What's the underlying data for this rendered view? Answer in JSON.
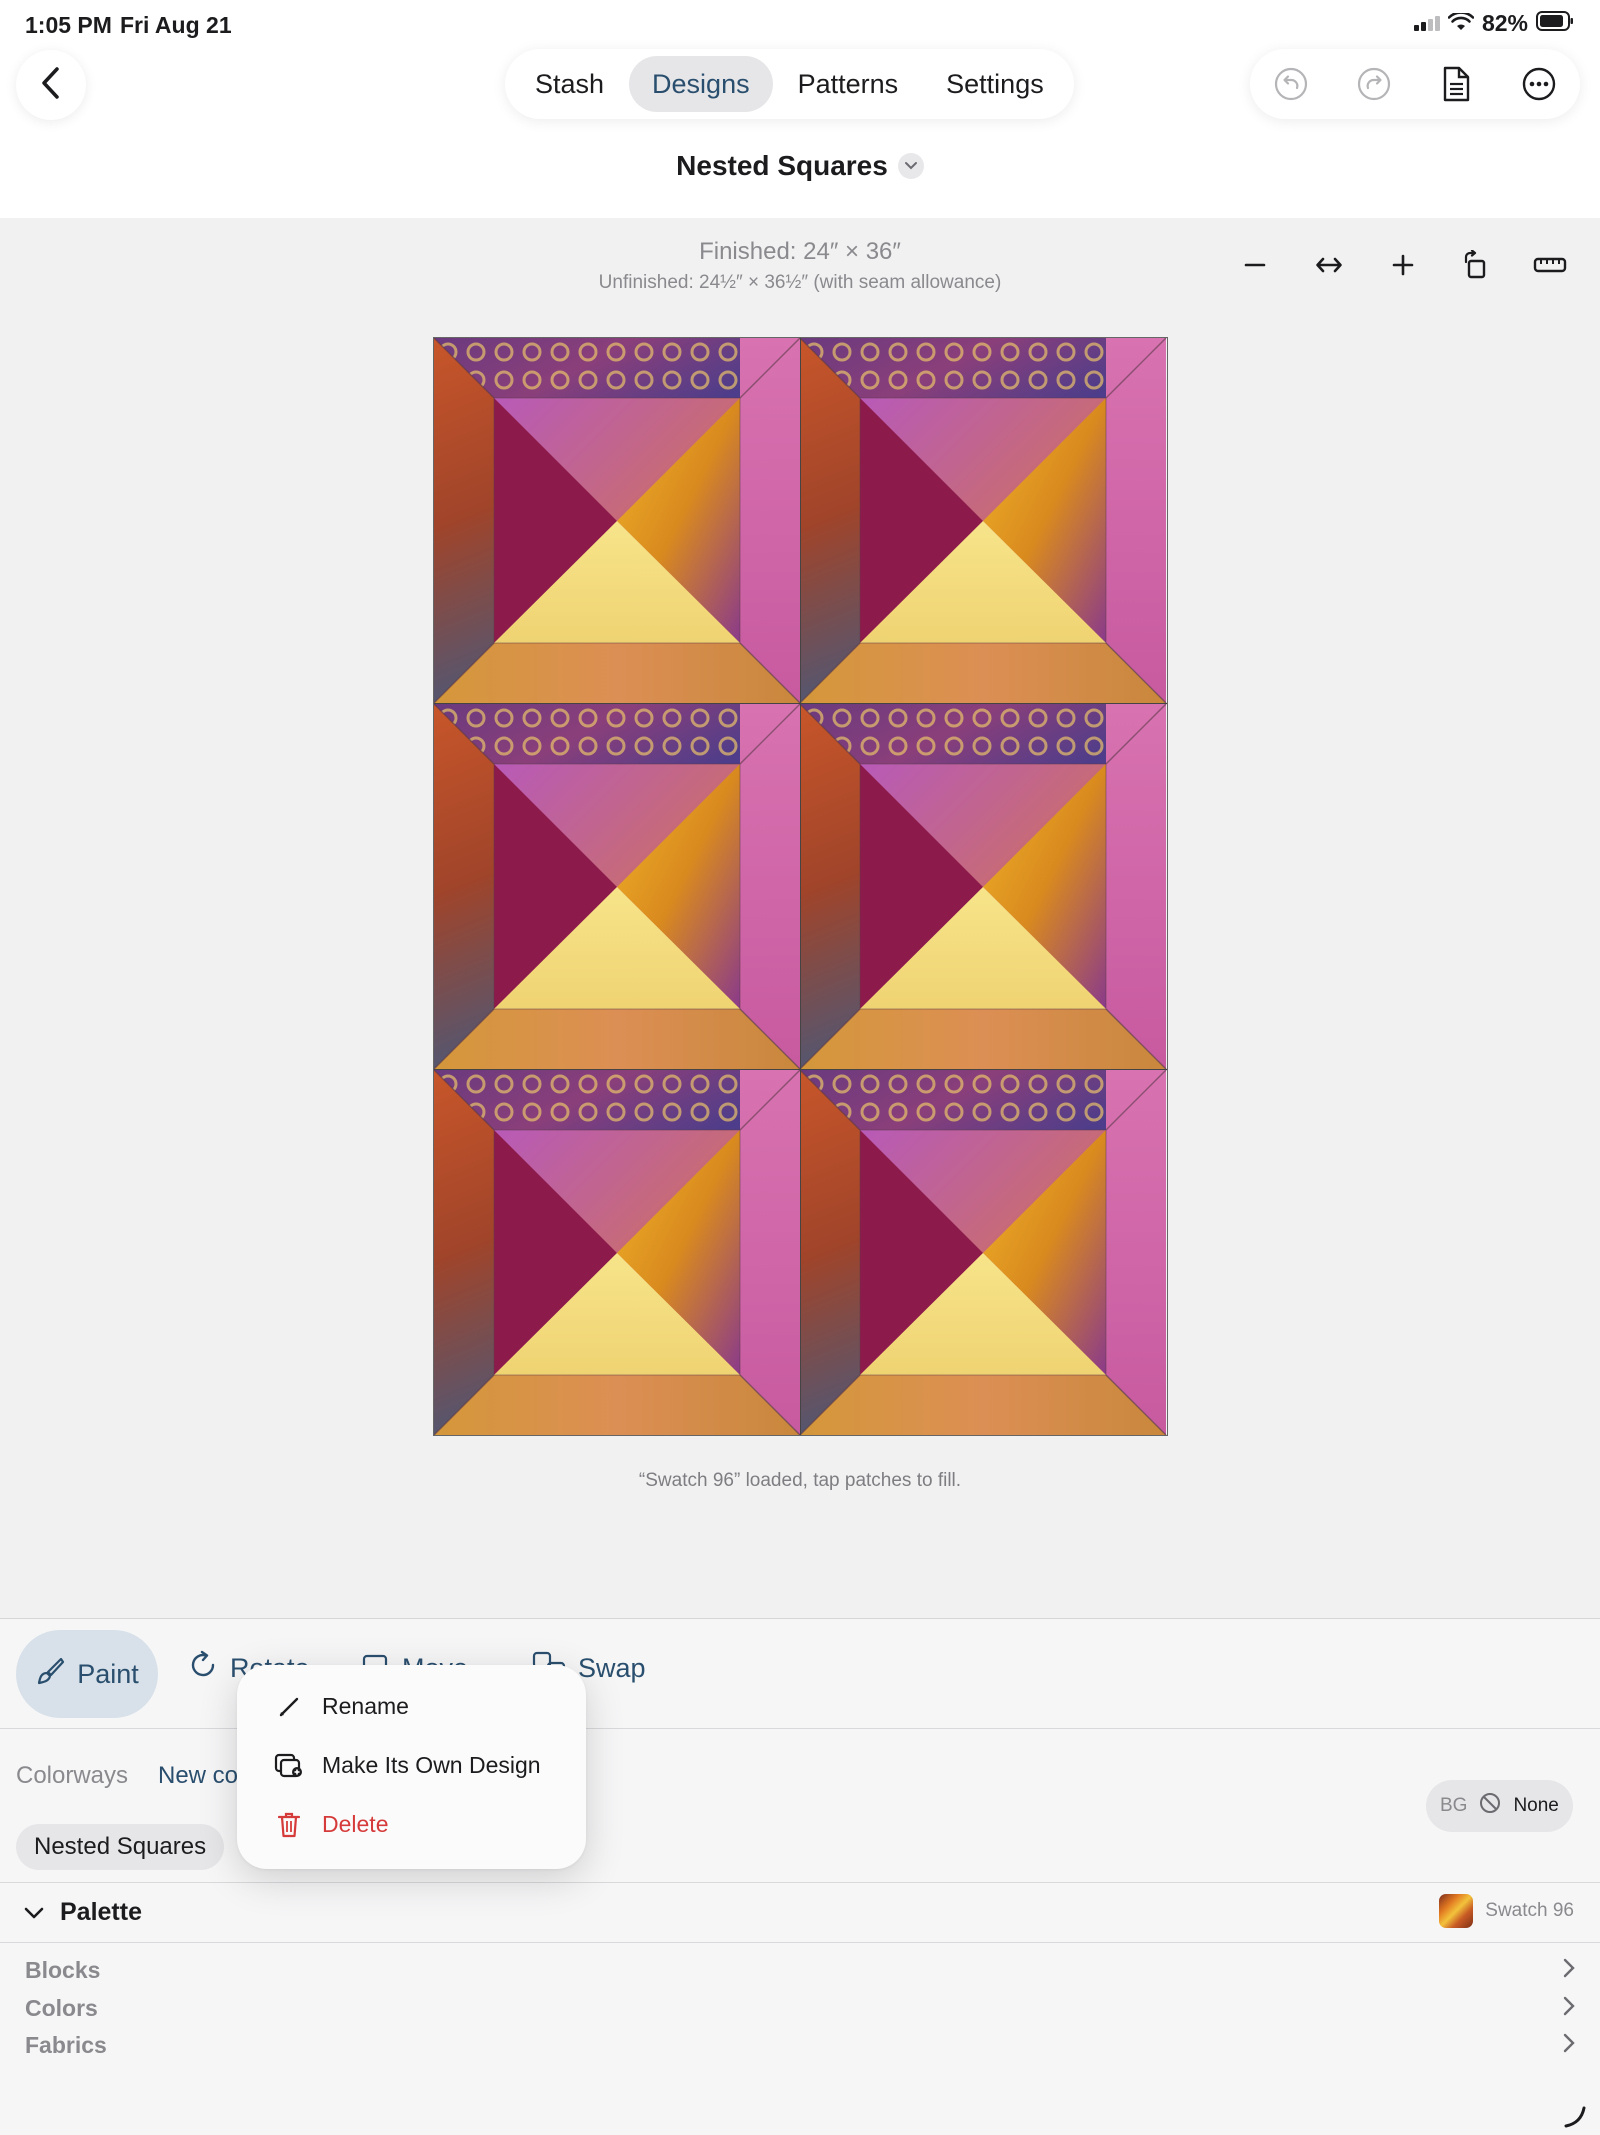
{
  "status_bar": {
    "time": "1:05 PM",
    "date": "Fri Aug 21",
    "battery": "82%"
  },
  "nav": {
    "tabs": [
      {
        "label": "Stash",
        "active": false
      },
      {
        "label": "Designs",
        "active": true
      },
      {
        "label": "Patterns",
        "active": false
      },
      {
        "label": "Settings",
        "active": false
      }
    ],
    "toolbar_icons": [
      "undo-icon",
      "redo-icon",
      "document-icon",
      "more-icon"
    ]
  },
  "design": {
    "title": "Nested Squares",
    "finished": "Finished: 24″ × 36″",
    "unfinished": "Unfinished: 24½″ × 36½″ (with seam allowance)"
  },
  "canvas": {
    "zoom_tools": [
      "zoom-out-icon",
      "fit-width-icon",
      "zoom-in-icon",
      "rotate-canvas-icon",
      "ruler-icon"
    ],
    "status_message": "“Swatch 96” loaded, tap patches to fill."
  },
  "tools": {
    "paint": "Paint",
    "rotate": "Rotate",
    "move": "Move",
    "swap": "Swap"
  },
  "colorways": {
    "label": "Colorways",
    "new": "New colorway",
    "items": [
      "Nested Squares"
    ]
  },
  "background": {
    "label": "BG",
    "value": "None"
  },
  "palette": {
    "title": "Palette",
    "current_swatch": "Swatch 96",
    "rows": [
      "Blocks",
      "Colors",
      "Fabrics"
    ]
  },
  "context_menu": {
    "items": [
      {
        "label": "Rename",
        "icon": "pencil-icon",
        "destructive": false
      },
      {
        "label": "Make Its Own Design",
        "icon": "duplicate-design-icon",
        "destructive": false
      },
      {
        "label": "Delete",
        "icon": "trash-icon",
        "destructive": true
      }
    ]
  },
  "colors": {
    "accent": "#2a4f6e",
    "destructive": "#d63b3b",
    "secondary_text": "#8a8a8e"
  }
}
